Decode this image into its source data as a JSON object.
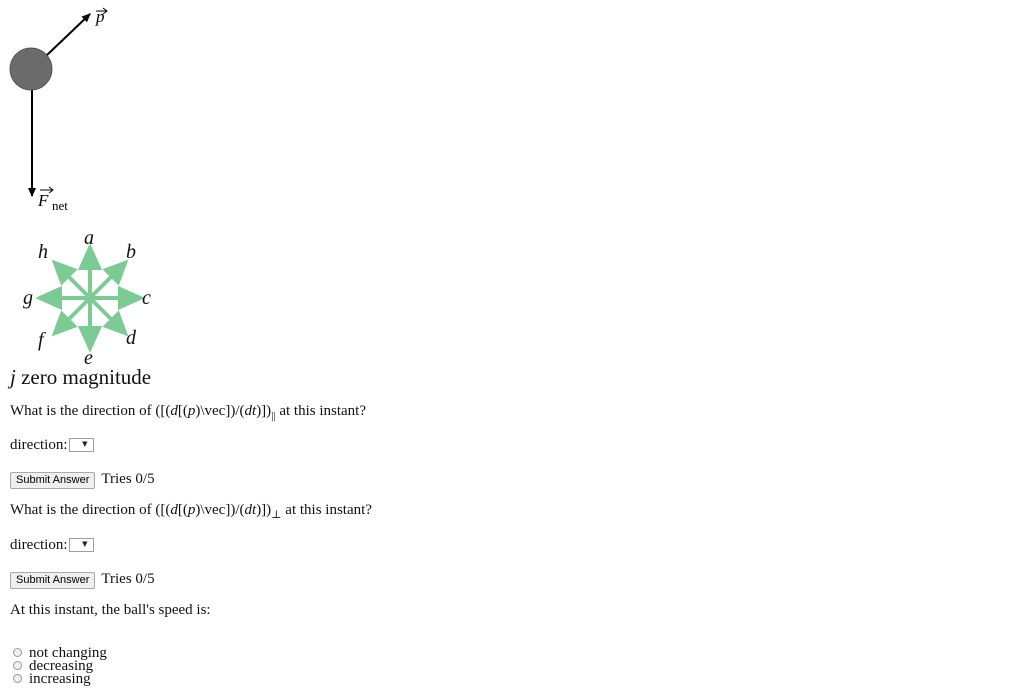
{
  "diagram": {
    "momentum_label": "p",
    "force_label": "F",
    "force_subscript": "net",
    "compass_labels": {
      "a": "a",
      "b": "b",
      "c": "c",
      "d": "d",
      "e": "e",
      "f": "f",
      "g": "g",
      "h": "h"
    },
    "arrow_color": "#7ccb94",
    "ball_color": "#6b6b6b"
  },
  "zero_option": {
    "letter": "j",
    "text": "zero magnitude"
  },
  "question1": {
    "prefix": "What is the direction of ([(",
    "d": "d",
    "bracket_open": "[(",
    "p": "p",
    "vec": ")\\vec]",
    "slash": ")/(",
    "dt": "dt",
    "close": ")])",
    "subscript": "||",
    "suffix": " at this instant?"
  },
  "question2": {
    "subscript": "⊥"
  },
  "direction_label": "direction:",
  "select_arrow": "▼",
  "submit_label": "Submit Answer",
  "tries_text": "Tries 0/5",
  "speed_question": "At this instant, the ball's speed is:",
  "speed_options": [
    "not changing",
    "decreasing",
    "increasing"
  ]
}
